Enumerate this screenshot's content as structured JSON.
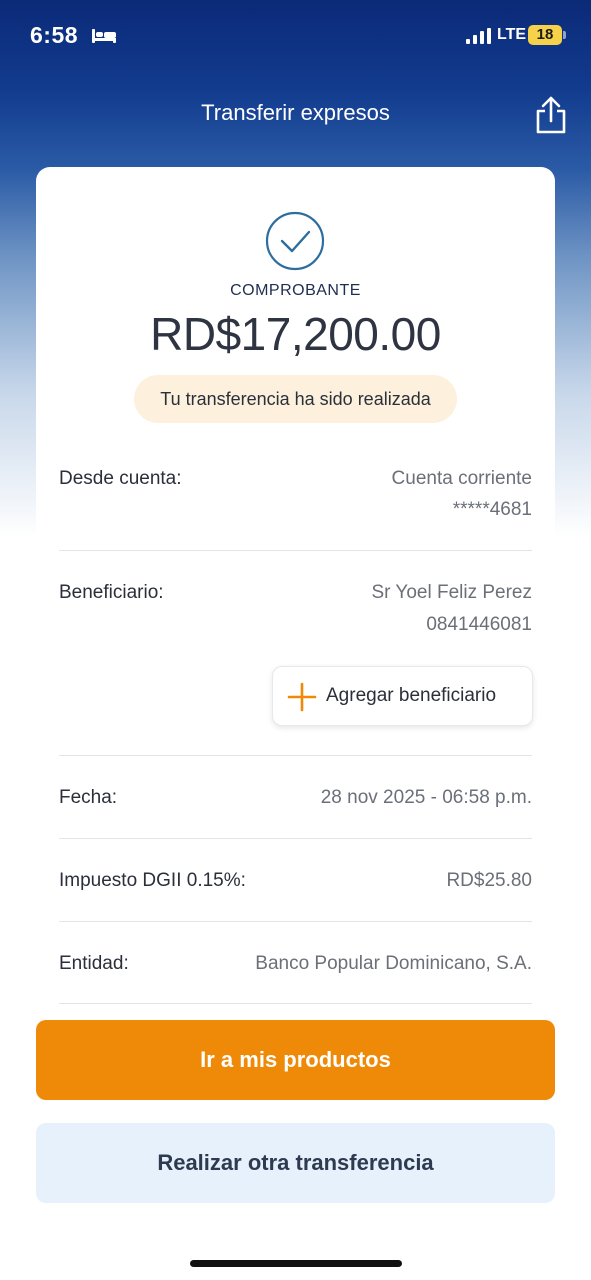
{
  "status_bar": {
    "time": "6:58",
    "network": "LTE",
    "battery": "18",
    "battery_color": "#f5d24a",
    "icons": [
      "bed-icon",
      "signal-icon"
    ]
  },
  "header": {
    "title": "Transferir expresos",
    "share_icon": "share-icon"
  },
  "receipt": {
    "icon": "check-circle-icon",
    "label": "COMPROBANTE",
    "amount": "RD$17,200.00",
    "status_message": "Tu transferencia ha sido realizada"
  },
  "details": {
    "from_account": {
      "label": "Desde cuenta:",
      "value_line1": "Cuenta corriente",
      "value_line2": "*****4681"
    },
    "beneficiary": {
      "label": "Beneficiario:",
      "value_line1": "Sr Yoel Feliz Perez",
      "value_line2": "0841446081",
      "add_button": "Agregar beneficiario",
      "add_icon": "plus-icon"
    },
    "date": {
      "label": "Fecha:",
      "value": "28 nov 2025 - 06:58 p.m."
    },
    "tax": {
      "label": "Impuesto DGII 0.15%:",
      "value": "RD$25.80"
    },
    "entity": {
      "label": "Entidad:",
      "value": "Banco Popular Dominicano, S.A."
    }
  },
  "actions": {
    "primary": "Ir a mis productos",
    "secondary": "Realizar otra transferencia"
  },
  "colors": {
    "primary": "#ef8a08",
    "accent_blue": "#2d6e9e",
    "header_blue": "#0b2a78",
    "success_bg": "#fdf0dd",
    "secondary_bg": "#e6f1fc"
  }
}
